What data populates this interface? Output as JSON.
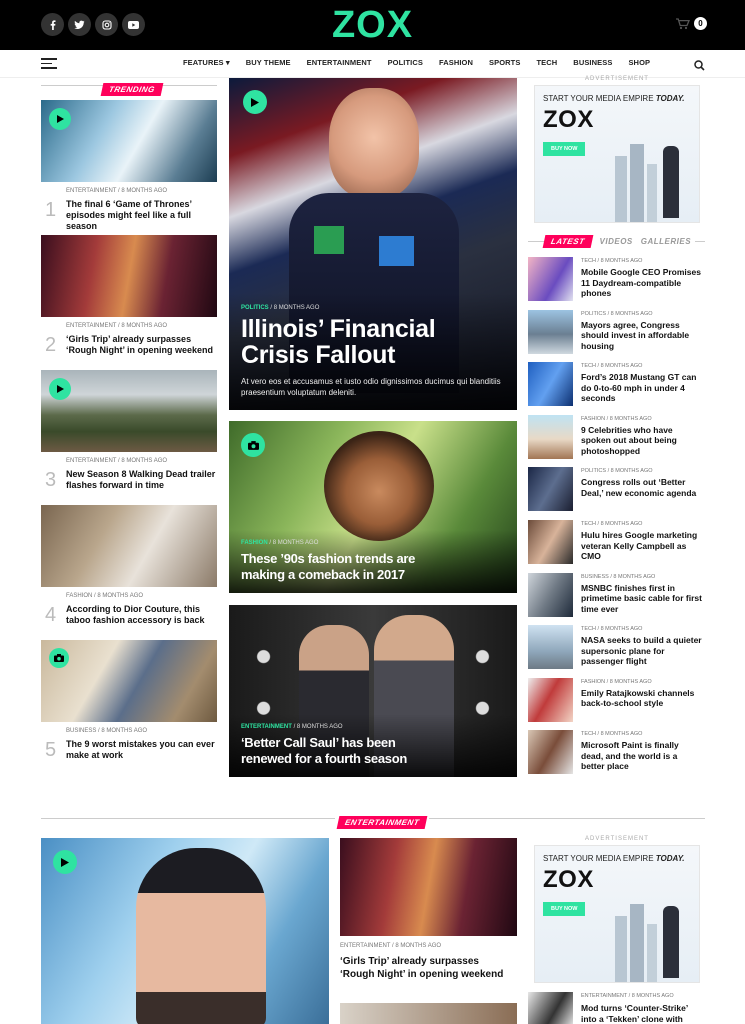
{
  "header": {
    "logo": "ZOX",
    "social": [
      "facebook-icon",
      "twitter-icon",
      "instagram-icon",
      "youtube-icon"
    ],
    "cart_count": "0",
    "accent": "#2fe3a1",
    "pink": "#ff005b"
  },
  "nav": {
    "items": [
      "FEATURES ▾",
      "BUY THEME",
      "ENTERTAINMENT",
      "POLITICS",
      "FASHION",
      "SPORTS",
      "TECH",
      "BUSINESS",
      "SHOP"
    ]
  },
  "trending": {
    "label": "TRENDING",
    "items": [
      {
        "num": "1",
        "cat": "ENTERTAINMENT",
        "time": "8 months ago",
        "title": "The final 6 ‘Game of Thrones’ episodes might feel like a full season",
        "icon": "play"
      },
      {
        "num": "2",
        "cat": "ENTERTAINMENT",
        "time": "8 months ago",
        "title": "‘Girls Trip’ already surpasses ‘Rough Night’ in opening weekend",
        "icon": ""
      },
      {
        "num": "3",
        "cat": "ENTERTAINMENT",
        "time": "8 months ago",
        "title": "New Season 8 Walking Dead trailer flashes forward in time",
        "icon": "play"
      },
      {
        "num": "4",
        "cat": "FASHION",
        "time": "8 months ago",
        "title": "According to Dior Couture, this taboo fashion accessory is back",
        "icon": ""
      },
      {
        "num": "5",
        "cat": "BUSINESS",
        "time": "8 months ago",
        "title": "The 9 worst mistakes you can ever make at work",
        "icon": "camera"
      }
    ]
  },
  "center": {
    "main": {
      "cat": "POLITICS",
      "time": "8 months ago",
      "title": "Illinois’ Financial Crisis Fallout",
      "excerpt": "At vero eos et accusamus et iusto odio dignissimos ducimus qui blanditiis praesentium voluptatum deleniti."
    },
    "second": {
      "cat": "FASHION",
      "time": "8 months ago",
      "title": "These ’90s fashion trends are making a comeback in 2017"
    },
    "third": {
      "cat": "ENTERTAINMENT",
      "time": "8 months ago",
      "title": "‘Better Call Saul’ has been renewed for a fourth season"
    }
  },
  "ad": {
    "label": "ADVERTISEMENT",
    "tagline": "START YOUR MEDIA EMPIRE",
    "tagline_em": "TODAY.",
    "brand": "ZOX",
    "button": "BUY NOW"
  },
  "latest": {
    "tabs": [
      "LATEST",
      "VIDEOS",
      "GALLERIES"
    ],
    "items": [
      {
        "cat": "TECH",
        "time": "8 months ago",
        "title": "Mobile Google CEO Promises 11 Daydream-compatible phones"
      },
      {
        "cat": "POLITICS",
        "time": "8 months ago",
        "title": "Mayors agree, Congress should invest in affordable housing"
      },
      {
        "cat": "TECH",
        "time": "8 months ago",
        "title": "Ford’s 2018 Mustang GT can do 0-to-60 mph in under 4 seconds"
      },
      {
        "cat": "FASHION",
        "time": "8 months ago",
        "title": "9 Celebrities who have spoken out about being photoshopped"
      },
      {
        "cat": "POLITICS",
        "time": "8 months ago",
        "title": "Congress rolls out ‘Better Deal,’ new economic agenda"
      },
      {
        "cat": "TECH",
        "time": "8 months ago",
        "title": "Hulu hires Google marketing veteran Kelly Campbell as CMO"
      },
      {
        "cat": "BUSINESS",
        "time": "8 months ago",
        "title": "MSNBC finishes first in primetime basic cable for first time ever"
      },
      {
        "cat": "TECH",
        "time": "8 months ago",
        "title": "NASA seeks to build a quieter supersonic plane for passenger flight"
      },
      {
        "cat": "FASHION",
        "time": "8 months ago",
        "title": "Emily Ratajkowski channels back-to-school style"
      },
      {
        "cat": "TECH",
        "time": "8 months ago",
        "title": "Microsoft Paint is finally dead, and the world is a better place"
      }
    ]
  },
  "entertainment": {
    "label": "ENTERTAINMENT",
    "mid": {
      "cat": "ENTERTAINMENT",
      "time": "8 months ago",
      "title": "‘Girls Trip’ already surpasses ‘Rough Night’ in opening weekend"
    },
    "right": {
      "cat": "ENTERTAINMENT",
      "time": "8 months ago",
      "title": "Mod turns ‘Counter-Strike’ into a ‘Tekken’ clone with fighting"
    }
  }
}
